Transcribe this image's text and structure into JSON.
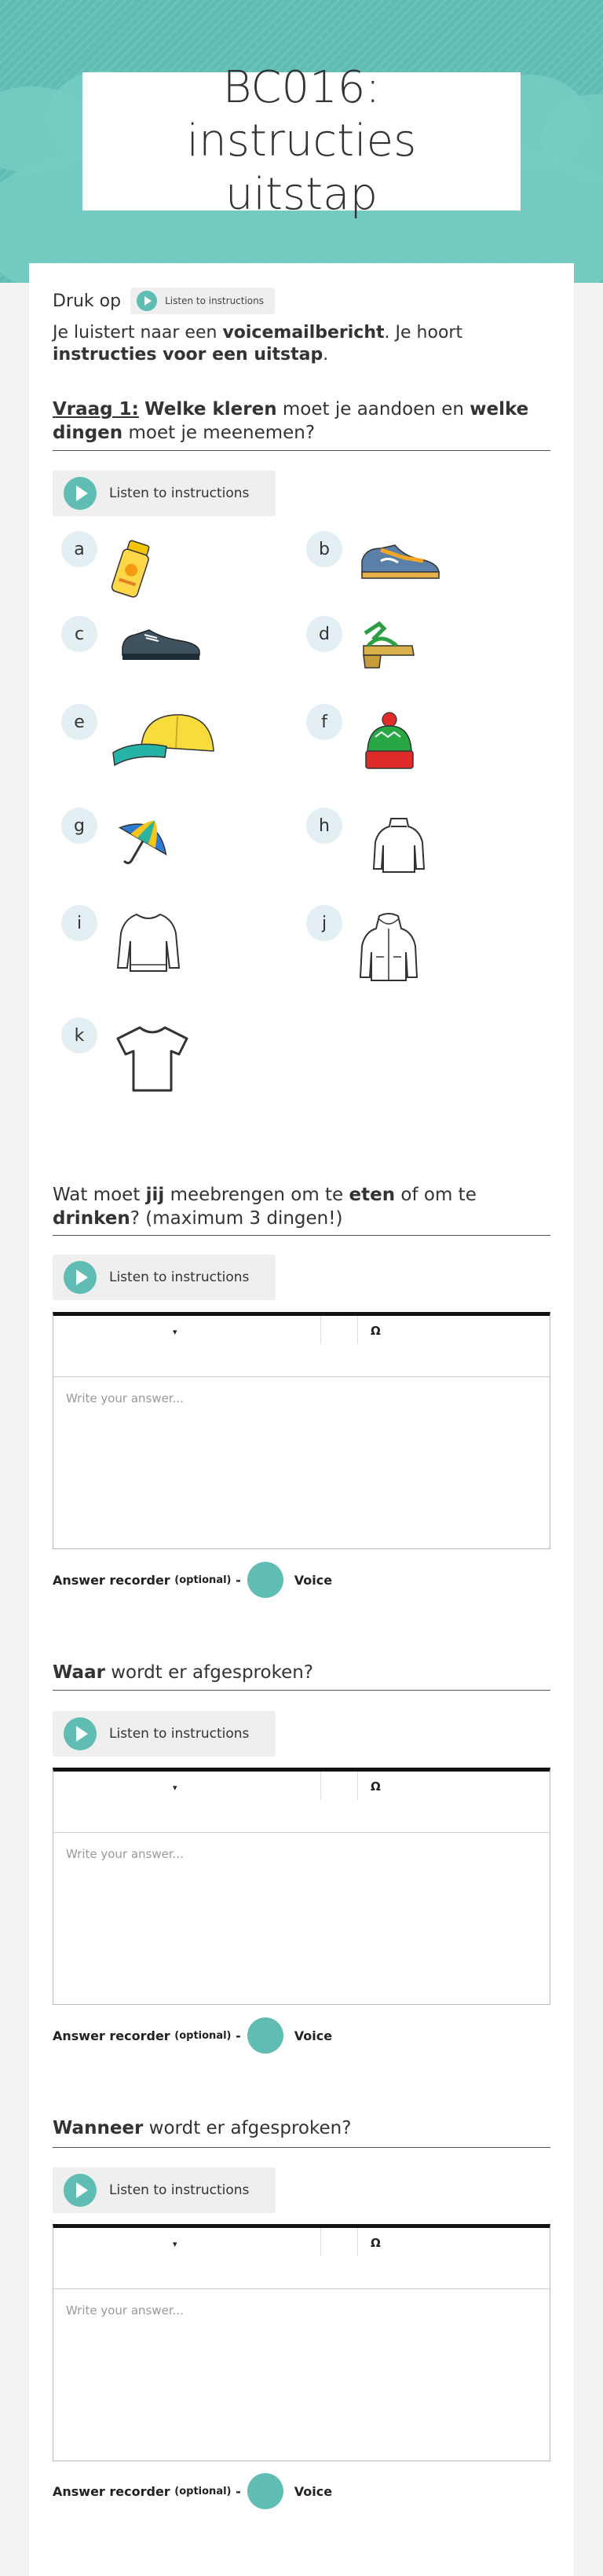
{
  "page": {
    "title": "BC016: instructies uitstap"
  },
  "intro": {
    "druk_op": "Druk op",
    "listen_label": "Listen to instructions",
    "text": [
      {
        "t": "Je luistert naar een ",
        "b": false
      },
      {
        "t": "voicemailbericht",
        "b": true
      },
      {
        "t": ". Je hoort ",
        "b": false
      },
      {
        "t": "instructies voor een uitstap",
        "b": true
      },
      {
        "t": ".",
        "b": false
      }
    ]
  },
  "q1": {
    "heading": [
      {
        "t": "Vraag 1:",
        "b": true,
        "u": true
      },
      {
        "t": " ",
        "b": false
      },
      {
        "t": "Welke kleren",
        "b": true
      },
      {
        "t": " moet je aandoen en ",
        "b": false
      },
      {
        "t": "welke dingen",
        "b": true
      },
      {
        "t": " moet je meenemen?",
        "b": false
      }
    ],
    "listen_label": "Listen to instructions",
    "options": [
      {
        "letter": "a",
        "icon": "sunscreen-icon"
      },
      {
        "letter": "b",
        "icon": "sneaker-icon"
      },
      {
        "letter": "c",
        "icon": "shoe-icon"
      },
      {
        "letter": "d",
        "icon": "sandal-icon"
      },
      {
        "letter": "e",
        "icon": "cap-icon"
      },
      {
        "letter": "f",
        "icon": "beanie-icon"
      },
      {
        "letter": "g",
        "icon": "umbrella-icon"
      },
      {
        "letter": "h",
        "icon": "turtleneck-icon"
      },
      {
        "letter": "i",
        "icon": "sweater-icon"
      },
      {
        "letter": "j",
        "icon": "jacket-icon"
      },
      {
        "letter": "k",
        "icon": "tshirt-icon"
      }
    ]
  },
  "q2": {
    "heading": [
      {
        "t": "Wat moet ",
        "b": false
      },
      {
        "t": "jij",
        "b": true
      },
      {
        "t": " meebrengen om te ",
        "b": false
      },
      {
        "t": "eten",
        "b": true
      },
      {
        "t": " of om te ",
        "b": false
      },
      {
        "t": "drinken",
        "b": true
      },
      {
        "t": "? (maximum 3 dingen!)",
        "b": false
      }
    ],
    "listen_label": "Listen to instructions",
    "placeholder": "Write your answer...",
    "recorder_label": "Answer recorder",
    "recorder_optional": "(optional)",
    "voice": "Voice"
  },
  "q3": {
    "heading": [
      {
        "t": "Waar",
        "b": true
      },
      {
        "t": " wordt er afgesproken?",
        "b": false
      }
    ],
    "listen_label": "Listen to instructions",
    "placeholder": "Write your answer...",
    "recorder_label": "Answer recorder",
    "recorder_optional": "(optional)",
    "voice": "Voice"
  },
  "q4": {
    "heading": [
      {
        "t": "Wanneer",
        "b": true
      },
      {
        "t": " wordt er afgesproken?",
        "b": false
      }
    ],
    "listen_label": "Listen to instructions",
    "placeholder": "Write your answer...",
    "recorder_label": "Answer recorder",
    "recorder_optional": "(optional)",
    "voice": "Voice"
  },
  "toolbar": {
    "dropdown_glyph": "▾",
    "special_char_glyph": "Ω"
  },
  "colors": {
    "accent": "#5fbdb3",
    "hero": "#5fbdb3"
  }
}
